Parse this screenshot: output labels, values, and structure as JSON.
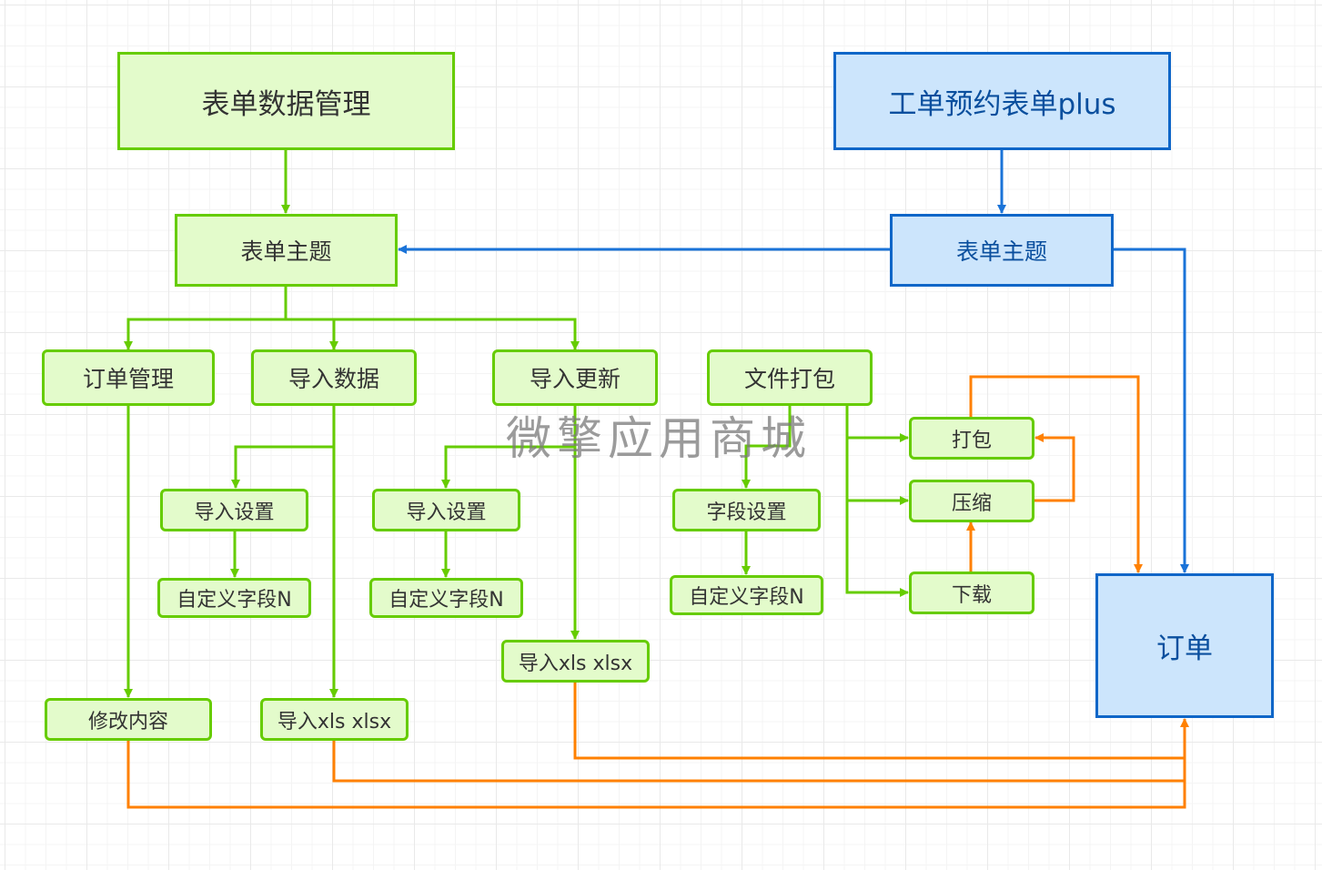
{
  "diagram": {
    "title_left": "表单数据管理",
    "title_right": "工单预约表单plus",
    "nodes": {
      "form_topic_left": "表单主题",
      "form_topic_right": "表单主题",
      "order_management": "订单管理",
      "import_data": "导入数据",
      "import_update": "导入更新",
      "file_packaging": "文件打包",
      "import_settings_1": "导入设置",
      "import_settings_2": "导入设置",
      "field_settings": "字段设置",
      "custom_field_1": "自定义字段N",
      "custom_field_2": "自定义字段N",
      "custom_field_3": "自定义字段N",
      "import_xls_update": "导入xls xlsx",
      "import_xls_data": "导入xls xlsx",
      "modify_content": "修改内容",
      "pack": "打包",
      "compress": "压缩",
      "download": "下载",
      "order": "订单"
    },
    "colors": {
      "green_stroke": "#66cc00",
      "green_fill": "#e3fbcb",
      "blue_stroke": "#0f66c8",
      "blue_fill": "#cce5fc",
      "orange": "#ff8000"
    }
  },
  "watermark": "微擎应用商城"
}
